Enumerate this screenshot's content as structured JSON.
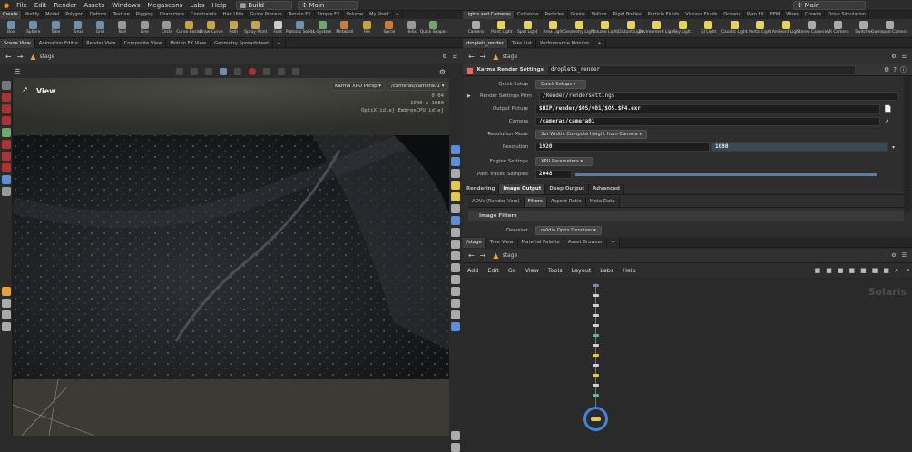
{
  "menubar": {
    "items": [
      "File",
      "Edit",
      "Render",
      "Assets",
      "Windows",
      "Megascans",
      "Labs",
      "Help"
    ],
    "desktop": "Build",
    "context": "Main",
    "right_context": "Main"
  },
  "shelf_left_tabs": [
    "Create",
    "Modify",
    "Model",
    "Polygon",
    "Deform",
    "Texture",
    "Rigging",
    "Characters",
    "Constraints",
    "Hair Utils",
    "Guide Process",
    "Terrain FX",
    "Simple FX",
    "Volume",
    "My Shelf"
  ],
  "shelf_right_tabs": [
    "Lights and Cameras",
    "Collisions",
    "Particles",
    "Grains",
    "Vellum",
    "Rigid Bodies",
    "Particle Fluids",
    "Viscous Fluids",
    "Oceans",
    "Pyro FX",
    "FEM",
    "Wires",
    "Crowds",
    "Drive Simulation"
  ],
  "tools_left": [
    {
      "label": "Box",
      "color": "#6f8fb0"
    },
    {
      "label": "Sphere",
      "color": "#6f8fb0"
    },
    {
      "label": "Tube",
      "color": "#6f8fb0"
    },
    {
      "label": "Torus",
      "color": "#6f8fb0"
    },
    {
      "label": "Grid",
      "color": "#6f8fb0"
    },
    {
      "label": "Null",
      "color": "#999999"
    },
    {
      "label": "Line",
      "color": "#999999"
    },
    {
      "label": "Circle",
      "color": "#999999"
    },
    {
      "label": "Curve Bezier",
      "color": "#c9a34a"
    },
    {
      "label": "Draw Curve",
      "color": "#c9a34a"
    },
    {
      "label": "Path",
      "color": "#c9a34a"
    },
    {
      "label": "Spray Paint",
      "color": "#c9a34a"
    },
    {
      "label": "Font",
      "color": "#cccccc"
    },
    {
      "label": "Platonic Solids",
      "color": "#6f8fb0"
    },
    {
      "label": "L-System",
      "color": "#6fa86f"
    },
    {
      "label": "Metaball",
      "color": "#d07a3a"
    },
    {
      "label": "File",
      "color": "#c9a34a"
    },
    {
      "label": "Spiral",
      "color": "#d07a3a"
    },
    {
      "label": "Helix",
      "color": "#999999"
    },
    {
      "label": "Quick Shapes",
      "color": "#6fa86f"
    }
  ],
  "tools_right": [
    {
      "label": "Camera",
      "color": "#aaaaaa"
    },
    {
      "label": "Point Light",
      "color": "#e8d35a"
    },
    {
      "label": "Spot Light",
      "color": "#e8d35a"
    },
    {
      "label": "Area Light",
      "color": "#e8d35a"
    },
    {
      "label": "Geometry Light",
      "color": "#e8d35a"
    },
    {
      "label": "Volume Light",
      "color": "#e8d35a"
    },
    {
      "label": "Distant Light",
      "color": "#e8d35a"
    },
    {
      "label": "Environment Light",
      "color": "#e8d35a"
    },
    {
      "label": "Sky Light",
      "color": "#e8d35a"
    },
    {
      "label": "GI Light",
      "color": "#e8d35a"
    },
    {
      "label": "Caustic Light",
      "color": "#e8d35a"
    },
    {
      "label": "Portal Light",
      "color": "#e8d35a"
    },
    {
      "label": "Ambient Light",
      "color": "#e8d35a"
    },
    {
      "label": "Stereo Camera",
      "color": "#aaaaaa"
    },
    {
      "label": "VR Camera",
      "color": "#aaaaaa"
    },
    {
      "label": "Switcher",
      "color": "#aaaaaa"
    },
    {
      "label": "Gamepad Camera",
      "color": "#aaaaaa"
    }
  ],
  "left_pane_tabs": [
    "Scene View",
    "Animation Editor",
    "Render View",
    "Composite View",
    "Motion FX View",
    "Geometry Spreadsheet"
  ],
  "left_path": "stage",
  "viewport": {
    "title": "View",
    "camera_menu": "Karma XPU Persp",
    "camera_path": "/cameras/camera01",
    "frame": "0:04",
    "resolution": "1920 x 1080",
    "status": "OptiX[idle] EmbreeCPU[idle]"
  },
  "right_top_tabs": [
    "droplets_render",
    "Take List",
    "Performance Monitor"
  ],
  "right_path": "stage",
  "params": {
    "node_type": "Karma Render Settings",
    "node_name": "droplets_render",
    "quick_setup_label": "Quick Setup",
    "quick_setup_value": "Quick Setups",
    "rs_prim_label": "Render Settings Prim",
    "rs_prim_value": "/Render/rendersettings",
    "output_label": "Output Picture",
    "output_value": "$HIP/render/$OS/v01/$OS.$F4.exr",
    "camera_label": "Camera",
    "camera_value": "/cameras/camera01",
    "resmode_label": "Resolution Mode",
    "resmode_value": "Set Width, Compute Height from Camera",
    "res_label": "Resolution",
    "res_w": "1920",
    "res_h": "1080",
    "engine_label": "Engine Settings",
    "engine_value": "XPU Parameters",
    "pts_label": "Path Traced Samples",
    "pts_value": "2048",
    "pts_fraction": 0.995,
    "tabs": [
      "Rendering",
      "Image Output",
      "Deep Output",
      "Advanced"
    ],
    "subtabs": [
      "AOVs (Render Vars)",
      "Filters",
      "Aspect Ratio",
      "Meta Data"
    ],
    "section": "Image Filters",
    "denoiser_label": "Denoiser",
    "denoiser_value": "nVidia Optix Denoiser"
  },
  "network_tabs": [
    "/stage",
    "Tree View",
    "Material Palette",
    "Asset Browser"
  ],
  "network_path": "stage",
  "network_menu": [
    "Add",
    "Edit",
    "Go",
    "View",
    "Tools",
    "Layout",
    "Labs",
    "Help"
  ],
  "network_context": "Solaris",
  "colors": {
    "accent": "#e6a13a",
    "node_gray": "#cfcfcf",
    "node_yellow": "#e3c84a",
    "node_teal": "#5fb8a6",
    "node_blue": "#5b8fd6",
    "selected_ring": "#3f86d9"
  }
}
